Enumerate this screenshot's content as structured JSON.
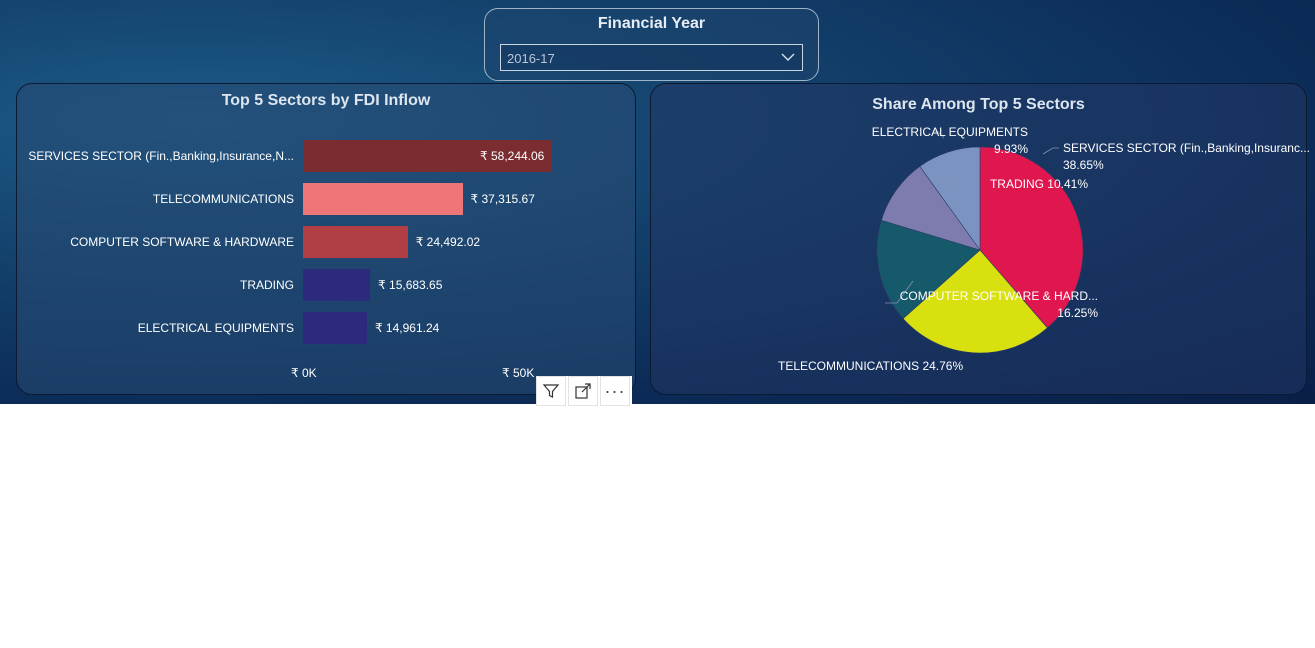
{
  "slicer": {
    "title": "Financial Year",
    "selected": "2016-17"
  },
  "bar_panel": {
    "title": "Top 5 Sectors by FDI Inflow",
    "axis_ticks": [
      "₹ 0K",
      "₹ 50K"
    ]
  },
  "pie_panel": {
    "title": "Share Among Top 5 Sectors"
  },
  "chart_data": [
    {
      "type": "bar",
      "orientation": "horizontal",
      "title": "Top 5 Sectors by FDI Inflow",
      "categories": [
        "SERVICES SECTOR (Fin.,Banking,Insurance,N...",
        "TELECOMMUNICATIONS",
        "COMPUTER SOFTWARE & HARDWARE",
        "TRADING",
        "ELECTRICAL EQUIPMENTS"
      ],
      "values": [
        58244.06,
        37315.67,
        24492.02,
        15683.65,
        14961.24
      ],
      "value_labels": [
        "₹ 58,244.06",
        "₹ 37,315.67",
        "₹ 24,492.02",
        "₹ 15,683.65",
        "₹ 14,961.24"
      ],
      "colors": [
        "#7b2c31",
        "#ef7678",
        "#b13d45",
        "#2c2a7c",
        "#2c2a7c"
      ],
      "xlim": [
        0,
        58244.06
      ],
      "grid": false
    },
    {
      "type": "pie",
      "title": "Share Among Top 5 Sectors",
      "labels": [
        "SERVICES SECTOR (Fin.,Banking,Insuranc...",
        "TELECOMMUNICATIONS",
        "COMPUTER SOFTWARE & HARD...",
        "TRADING",
        "ELECTRICAL EQUIPMENTS"
      ],
      "values": [
        38.65,
        24.76,
        16.25,
        10.41,
        9.93
      ],
      "value_labels": [
        "38.65%",
        "24.76%",
        "16.25%",
        "10.41%",
        "9.93%"
      ],
      "colors": [
        "#e0174f",
        "#d8e00f",
        "#15596b",
        "#7e7cae",
        "#7b93c0"
      ]
    }
  ],
  "toolbar": {
    "filter_icon": "filter-icon",
    "focus_icon": "focus-mode-icon",
    "more_icon": "more-options-icon",
    "more_glyph": "···"
  }
}
